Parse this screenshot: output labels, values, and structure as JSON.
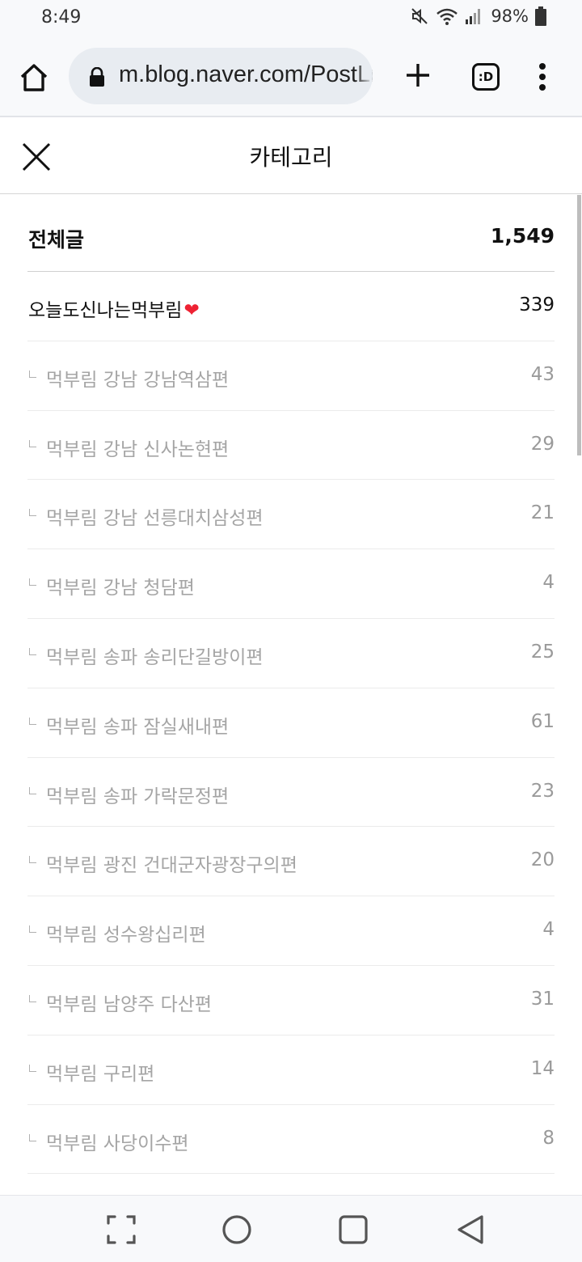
{
  "status_bar": {
    "time": "8:49",
    "battery": "98%",
    "icons": [
      "mute-icon",
      "wifi-icon",
      "signal-icon",
      "battery-icon"
    ]
  },
  "browser": {
    "url": "m.blog.naver.com/PostList",
    "tabs_label": ":D",
    "icons": [
      "home-icon",
      "lock-icon",
      "plus-icon",
      "tabs-icon",
      "more-vertical-icon"
    ]
  },
  "header": {
    "title": "카테고리",
    "close_icon": "close-icon"
  },
  "categories": {
    "total": {
      "name": "전체글",
      "count": "1,549"
    },
    "parent": {
      "name": "오늘도신나는먹부림",
      "emoji": "❤",
      "count": "339"
    },
    "children": [
      {
        "name": "먹부림 강남 강남역삼편",
        "count": "43"
      },
      {
        "name": "먹부림 강남 신사논현편",
        "count": "29"
      },
      {
        "name": "먹부림 강남 선릉대치삼성편",
        "count": "21"
      },
      {
        "name": "먹부림 강남 청담편",
        "count": "4"
      },
      {
        "name": "먹부림 송파 송리단길방이편",
        "count": "25"
      },
      {
        "name": "먹부림 송파 잠실새내편",
        "count": "61"
      },
      {
        "name": "먹부림 송파 가락문정편",
        "count": "23"
      },
      {
        "name": "먹부림 광진 건대군자광장구의편",
        "count": "20"
      },
      {
        "name": "먹부림 성수왕십리편",
        "count": "4"
      },
      {
        "name": "먹부림 남양주 다산편",
        "count": "31"
      },
      {
        "name": "먹부림 구리편",
        "count": "14"
      },
      {
        "name": "먹부림 사당이수편",
        "count": "8"
      }
    ]
  },
  "nav_bar": {
    "icons": [
      "recents-icon",
      "home-circle-icon",
      "overview-square-icon",
      "back-triangle-icon"
    ]
  },
  "colors": {
    "accent_heart": "#ee2233",
    "subcategory_text": "#a5a5a5",
    "chrome_bg": "#f8f9fb",
    "urlbar_bg": "#e8ecf1"
  }
}
